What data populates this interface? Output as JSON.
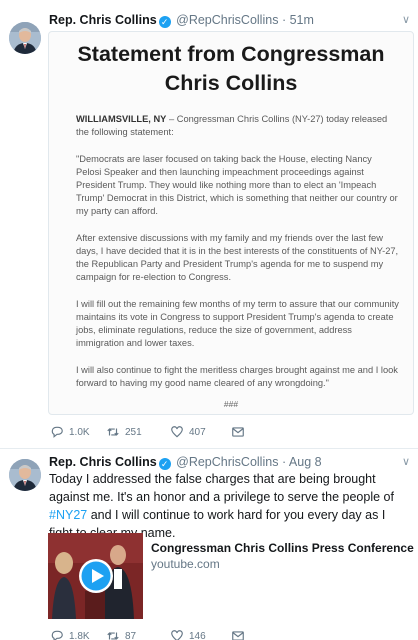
{
  "tweets": [
    {
      "author_name": "Rep. Chris Collins",
      "handle": "@RepChrisCollins",
      "separator": "·",
      "time": "51m",
      "statement": {
        "title_line1": "Statement from Congressman",
        "title_line2": "Chris Collins",
        "place": "WILLIAMSVILLE, NY",
        "intro": " – Congressman Chris Collins (NY-27) today released the following statement:",
        "paragraphs": [
          "\"Democrats are laser focused on taking back the House, electing Nancy Pelosi Speaker and then launching impeachment proceedings against President Trump. They would like nothing more than to elect an 'Impeach Trump' Democrat in this District, which is something that neither our country or my party can afford.",
          "After extensive discussions with my family and my friends over the last few days, I have decided that it is in the best interests of the constituents of NY-27, the Republican Party and President Trump's agenda for me to suspend my campaign for re-election to Congress.",
          "I will fill out the remaining few months of my term to assure that our community maintains its vote in Congress to support President Trump's agenda to create jobs, eliminate regulations, reduce the size of government, address immigration and lower taxes.",
          "I will also continue to fight the meritless charges brought against me and I look forward to having my good name cleared of any wrongdoing.\""
        ],
        "end_mark": "###"
      },
      "actions": {
        "replies": "1.0K",
        "retweets": "251",
        "likes": "407"
      }
    },
    {
      "author_name": "Rep. Chris Collins",
      "handle": "@RepChrisCollins",
      "separator": "·",
      "time": "Aug 8",
      "text_before": "Today I addressed the false charges that are being brought against me. It's an honor and a privilege to serve the people of ",
      "hashtag": "#NY27",
      "text_after": " and I will continue to work hard for you every day as I fight to clear my name.",
      "link_card": {
        "title": "Congressman Chris Collins Press Conference",
        "domain": "youtube.com"
      },
      "actions": {
        "replies": "1.8K",
        "retweets": "87",
        "likes": "146"
      }
    }
  ],
  "colors": {
    "accent": "#1da1f2",
    "secondary_text": "#657786",
    "divider": "#e6ecf0"
  },
  "icons": [
    "verified-badge-icon",
    "chevron-down-icon",
    "reply-icon",
    "retweet-icon",
    "like-icon",
    "direct-message-icon",
    "play-icon"
  ]
}
